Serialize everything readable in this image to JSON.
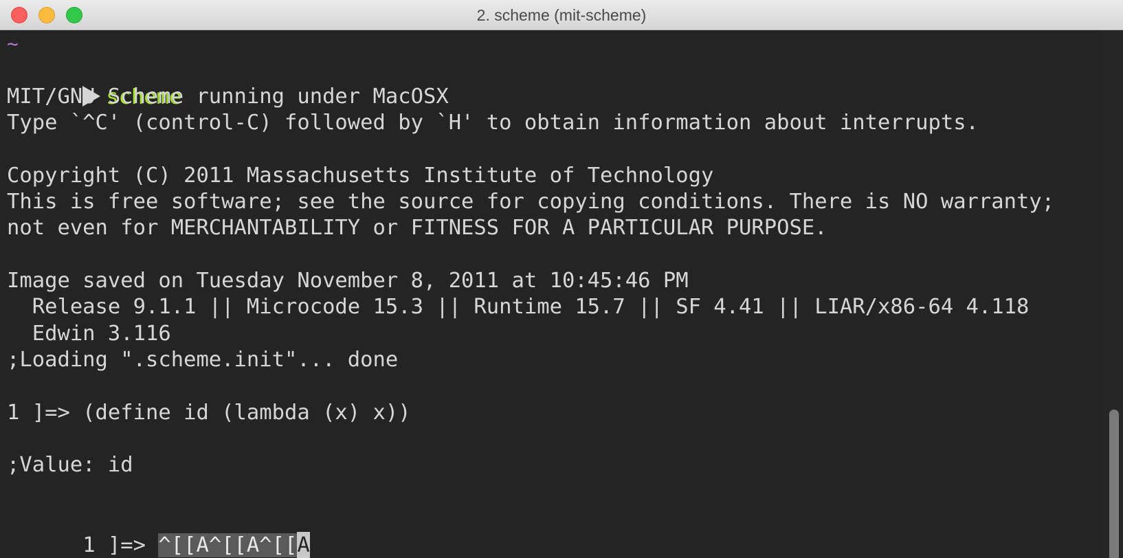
{
  "window": {
    "title": "2. scheme (mit-scheme)"
  },
  "terminal": {
    "lines": {
      "l0": "~",
      "l1_cmd": "scheme",
      "l2": "MIT/GNU Scheme running under MacOSX",
      "l3": "Type `^C' (control-C) followed by `H' to obtain information about interrupts.",
      "l5": "Copyright (C) 2011 Massachusetts Institute of Technology",
      "l6": "This is free software; see the source for copying conditions. There is NO warranty;",
      "l7": "not even for MERCHANTABILITY or FITNESS FOR A PARTICULAR PURPOSE.",
      "l9": "Image saved on Tuesday November 8, 2011 at 10:45:46 PM",
      "l10": "  Release 9.1.1 || Microcode 15.3 || Runtime 15.7 || SF 4.41 || LIAR/x86-64 4.118",
      "l11": "  Edwin 3.116",
      "l12": ";Loading \".scheme.init\"... done",
      "l14": "1 ]=> (define id (lambda (x) x))",
      "l16": ";Value: id",
      "l18_prompt": "1 ]=> ",
      "l18_input": "^[[A^[[A^[[",
      "l18_cursor": "A"
    }
  },
  "colors": {
    "background": "#242424",
    "text": "#d6d6d6",
    "command": "#a6e22e",
    "tilde": "#b07cd8"
  }
}
